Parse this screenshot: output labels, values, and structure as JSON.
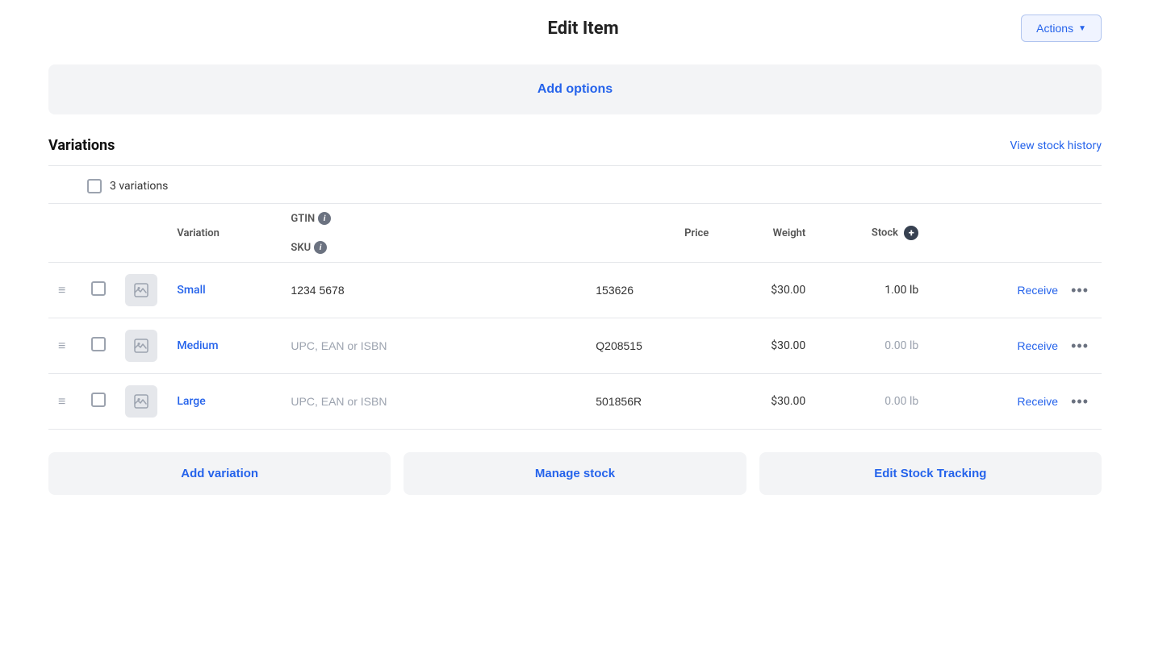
{
  "header": {
    "title": "Edit Item",
    "actions_label": "Actions"
  },
  "add_options": {
    "label": "Add options"
  },
  "variations_section": {
    "title": "Variations",
    "view_stock_history": "View stock history",
    "select_all_label": "3 variations",
    "columns": {
      "variation": "Variation",
      "gtin": "GTIN",
      "sku": "SKU",
      "price": "Price",
      "weight": "Weight",
      "stock": "Stock"
    },
    "rows": [
      {
        "id": "small",
        "name": "Small",
        "gtin": "1234 5678",
        "gtin_placeholder": "UPC, EAN or ISBN",
        "sku": "153626",
        "price": "$30.00",
        "weight": "1.00 lb",
        "weight_filled": true,
        "receive_label": "Receive"
      },
      {
        "id": "medium",
        "name": "Medium",
        "gtin": "",
        "gtin_placeholder": "UPC, EAN or ISBN",
        "sku": "Q208515",
        "price": "$30.00",
        "weight": "0.00 lb",
        "weight_filled": false,
        "receive_label": "Receive"
      },
      {
        "id": "large",
        "name": "Large",
        "gtin": "",
        "gtin_placeholder": "UPC, EAN or ISBN",
        "sku": "501856R",
        "price": "$30.00",
        "weight": "0.00 lb",
        "weight_filled": false,
        "receive_label": "Receive"
      }
    ],
    "bottom_buttons": [
      {
        "id": "add-variation",
        "label": "Add variation"
      },
      {
        "id": "manage-stock",
        "label": "Manage stock"
      },
      {
        "id": "edit-stock-tracking",
        "label": "Edit Stock Tracking"
      }
    ]
  },
  "colors": {
    "blue": "#2563eb",
    "gray_text": "#9ca3af",
    "border": "#e5e7eb"
  }
}
